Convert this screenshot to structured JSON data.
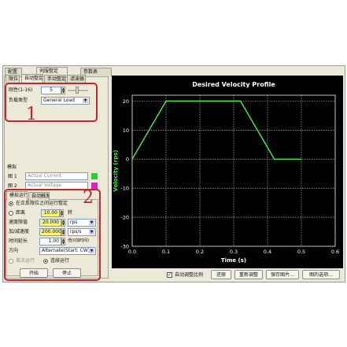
{
  "top_tabs": [
    "配置",
    "伺服整定",
    "参数表"
  ],
  "sub_tabs": [
    "限位",
    "自动整定",
    "手动整定",
    "滤波器"
  ],
  "stiffness": {
    "label": "刚性(1-16)",
    "value": "5"
  },
  "load_type": {
    "label": "负载类型",
    "value": "General Load"
  },
  "annotation_1": "1",
  "annotation_2": "2",
  "scope": {
    "title": "模拟",
    "rows": [
      {
        "label": "图 1",
        "value": "Actual Current",
        "color": "#33cc33"
      },
      {
        "label": "图 2",
        "value": "Actual Voltage",
        "color": "#e020c8"
      }
    ]
  },
  "sim_tabs": [
    "模拟运行",
    "自动触发"
  ],
  "sim": {
    "mode_limits": "在正反限位之间运行整定",
    "mode_distance": "距离",
    "distance_value": "10.00",
    "distance_unit": "转",
    "speed_label": "速度限值",
    "speed_value": "20.000",
    "speed_unit": "rps",
    "accel_label": "加/减速度",
    "accel_value": "200.000",
    "accel_unit": "rps/s",
    "time_label": "时间延长",
    "time_value": "1.00",
    "time_note": "倍(0加时间)",
    "dir_label": "方向",
    "dir_value": "Alternate(Start: CW)",
    "single_run": "单次运行",
    "cont_run": "连续运行",
    "start": "开始",
    "stop": "停止"
  },
  "bottom": {
    "auto_scale": "自动调整比例",
    "restore": "还原",
    "retune": "重新调整",
    "save_image": "保存图片...",
    "chart_options": "图的选项..."
  },
  "chart_data": {
    "type": "line",
    "title": "Desired Velocity Profile",
    "xlabel": "Time (s)",
    "ylabel": "Velocity (rps)",
    "xlim": [
      0,
      0.6
    ],
    "ylim": [
      -30,
      22
    ],
    "xticks": [
      "0.0",
      "0.1",
      "0.2",
      "0.3",
      "0.4",
      "0.5",
      "0.6"
    ],
    "yticks": [
      "20",
      "10",
      "0",
      "-10",
      "-20",
      "-30"
    ],
    "grid": true,
    "series": [
      {
        "color": "#4dff4d",
        "x": [
          0.0,
          0.1,
          0.32,
          0.42,
          0.5
        ],
        "y": [
          0,
          20,
          20,
          0,
          0
        ]
      }
    ]
  }
}
